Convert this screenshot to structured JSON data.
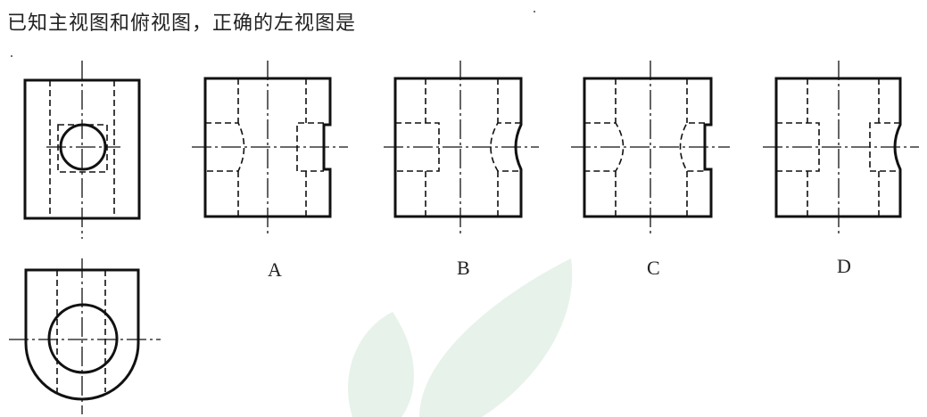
{
  "question": {
    "text": "已知主视图和俯视图，正确的左视图是"
  },
  "options": [
    {
      "label": "A"
    },
    {
      "label": "B"
    },
    {
      "label": "C"
    },
    {
      "label": "D"
    }
  ],
  "colors": {
    "line": "#111111",
    "watermark": "#e7f2ea"
  }
}
